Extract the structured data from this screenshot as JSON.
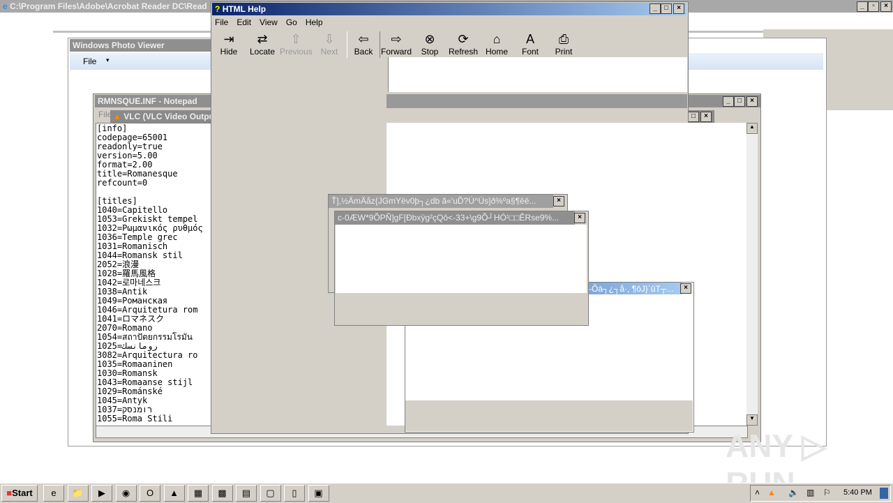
{
  "ie": {
    "title": "C:\\Program Files\\Adobe\\Acrobat Reader DC\\Read"
  },
  "photo": {
    "title": "Windows Photo Viewer",
    "menu_file": "File",
    "menu_arrow": "▾"
  },
  "notepad": {
    "title": "RMNSQUE.INF - Notepad",
    "menu_file": "File",
    "lines": [
      "[info]",
      "codepage=65001",
      "readonly=true",
      "version=5.00",
      "format=2.00",
      "title=Romanesque",
      "refcount=0",
      "",
      "[titles]",
      "1040=Capitello",
      "1053=Grekiskt tempel",
      "1032=Ρωμανικός ρυθμός",
      "1036=Temple grec",
      "1031=Romanisch",
      "1044=Romansk stil",
      "2052=浪漫",
      "1028=羅馬風格",
      "1042=로마네스크",
      "1038=Antik",
      "1049=Романская",
      "1046=Arquitetura rom",
      "1041=ロマネスク",
      "2070=Romano",
      "1054=สถาปัตยกรรมโรมัน",
      "1025=رومانسك",
      "3082=Arquitectura ro",
      "1035=Romaaninen",
      "1030=Romansk",
      "1043=Romaanse stijl",
      "1029=Románské",
      "1045=Antyk",
      "1037=רומנסק",
      "1055=Roma Stili"
    ]
  },
  "vlc": {
    "title": "VLC (VLC Video Output)"
  },
  "help": {
    "title": "HTML Help",
    "menu": [
      "File",
      "Edit",
      "View",
      "Go",
      "Help"
    ],
    "toolbar": [
      {
        "label": "Hide",
        "icon": "hide-icon",
        "glyph": "⇥",
        "enabled": true
      },
      {
        "label": "Locate",
        "icon": "locate-icon",
        "glyph": "⇄",
        "enabled": true
      },
      {
        "label": "Previous",
        "icon": "up-arrow-icon",
        "glyph": "⇧",
        "enabled": false
      },
      {
        "label": "Next",
        "icon": "down-arrow-icon",
        "glyph": "⇩",
        "enabled": false
      },
      {
        "label": "Back",
        "icon": "back-arrow-icon",
        "glyph": "⇦",
        "enabled": true
      },
      {
        "label": "Forward",
        "icon": "forward-arrow-icon",
        "glyph": "⇨",
        "enabled": true
      },
      {
        "label": "Stop",
        "icon": "stop-icon",
        "glyph": "⊗",
        "enabled": true
      },
      {
        "label": "Refresh",
        "icon": "refresh-icon",
        "glyph": "⟳",
        "enabled": true
      },
      {
        "label": "Home",
        "icon": "home-icon",
        "glyph": "⌂",
        "enabled": true
      },
      {
        "label": "Font",
        "icon": "font-icon",
        "glyph": "A",
        "enabled": true
      },
      {
        "label": "Print",
        "icon": "print-icon",
        "glyph": "⎙",
        "enabled": true
      }
    ]
  },
  "dialog1": {
    "title": "Ť],½ÄmÄåz{JGmYëv0þ┐¿db ã«'uĎ?Ú^Ús]ð%ºa§¶êê..."
  },
  "dialog2": {
    "title": "c-0ÆW*9ÕPÑ]gF[Ðbxÿg²çQô<-33+\\g9Õ┘HÓ¹□□ÊRse9%..."
  },
  "dialog3": {
    "title": "-Ôà┐¿┐å·, ¶ôJ}`ûT┬..."
  },
  "taskbar": {
    "start": "Start",
    "clock": "5:40 PM",
    "apps": [
      "ie-icon",
      "explorer-icon",
      "media-player-icon",
      "chrome-icon",
      "opera-icon",
      "app-icon",
      "app-icon",
      "winrar-icon",
      "app-icon",
      "app-icon",
      "file-icon",
      "app-icon"
    ]
  },
  "watermark": "ANY ▷ RUN",
  "colors": {
    "title_active": "#0a246a",
    "title_inactive": "#8f8f8f",
    "face": "#d4d0c8"
  }
}
